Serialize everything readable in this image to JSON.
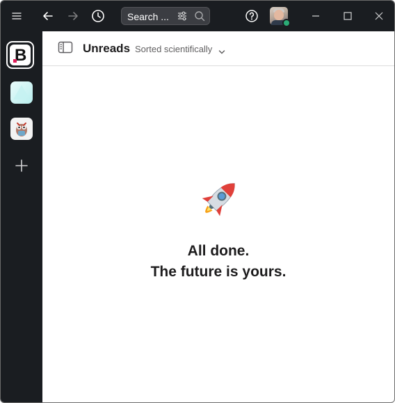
{
  "titlebar": {
    "search_placeholder": "Search ...",
    "icons": [
      "menu-icon",
      "back-arrow-icon",
      "forward-arrow-icon",
      "history-icon",
      "filter-icon",
      "search-icon",
      "help-icon",
      "minimize-icon",
      "maximize-icon",
      "close-icon"
    ]
  },
  "workspaces": {
    "active_letter": "B",
    "items": [
      "workspace-b",
      "workspace-teal",
      "workspace-mascot"
    ],
    "add_icon": "plus-icon"
  },
  "header": {
    "title": "Unreads",
    "sort_label": "Sorted scientifically"
  },
  "empty_state": {
    "icon": "rocket-icon",
    "line1": "All done.",
    "line2": "The future is yours."
  },
  "colors": {
    "chrome": "#1a1d21",
    "presence": "#2bac76",
    "accent_dot": "#e01e5a"
  }
}
